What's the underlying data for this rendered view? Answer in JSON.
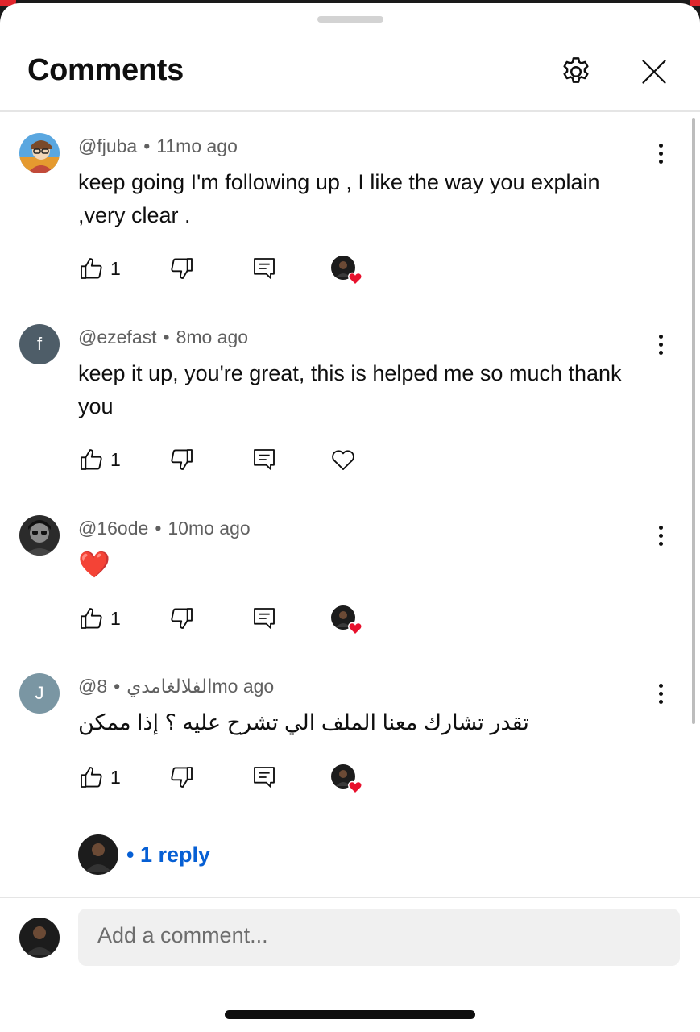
{
  "header": {
    "title": "Comments",
    "settings_icon": "gear-icon",
    "close_icon": "close-icon"
  },
  "comments": [
    {
      "author": "@fjuba",
      "separator": "•",
      "time": "11mo ago",
      "text": "keep going I'm following up , I like the way you explain ,very clear .",
      "likes": "1",
      "creator_hearted": true
    },
    {
      "author": "@ezefast",
      "separator": "•",
      "time": "8mo ago",
      "text": "keep it up, you're great, this is helped me so much thank you",
      "likes": "1",
      "creator_hearted": false,
      "avatar_letter": "f",
      "avatar_color": "#4e5d68"
    },
    {
      "author": "@16ode",
      "separator": "•",
      "time": "10mo ago",
      "text": "❤️",
      "likes": "1",
      "creator_hearted": true
    },
    {
      "author": "@الفلالغامدي",
      "separator": "•",
      "time": "8mo ago",
      "text": "تقدر تشارك معنا الملف الي تشرح عليه ؟ إذا ممكن",
      "likes": "1",
      "creator_hearted": true,
      "avatar_letter": "J",
      "avatar_color": "#7a96a3"
    }
  ],
  "replies": {
    "prefix": "•",
    "label": "1 reply"
  },
  "composer": {
    "placeholder": "Add a comment..."
  },
  "colors": {
    "link_blue": "#065fd4",
    "heart_red": "#e8112d"
  }
}
